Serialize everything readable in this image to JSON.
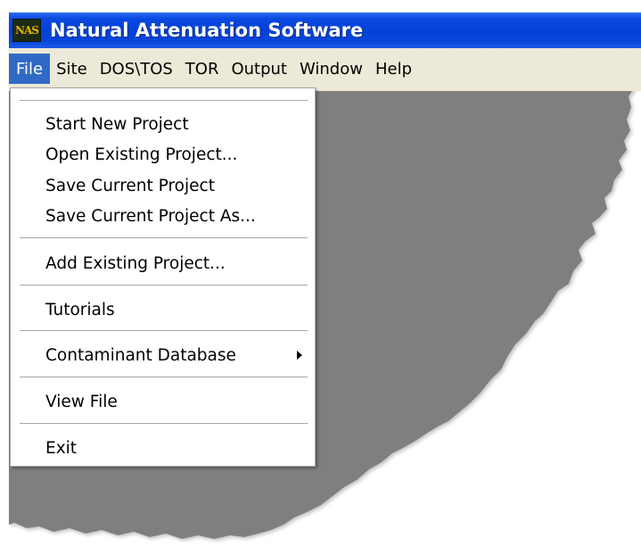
{
  "window": {
    "title": "Natural Attenuation Software",
    "icon_text": "NAS"
  },
  "menubar": {
    "items": [
      {
        "label": "File",
        "active": true
      },
      {
        "label": "Site"
      },
      {
        "label": "DOS\\TOS"
      },
      {
        "label": "TOR"
      },
      {
        "label": "Output"
      },
      {
        "label": "Window"
      },
      {
        "label": "Help"
      }
    ]
  },
  "file_menu": {
    "items": [
      "Start New Project",
      "Open Existing Project...",
      "Save Current Project",
      "Save Current Project As...",
      "Add Existing Project...",
      "Tutorials",
      "Contaminant Database",
      "View File",
      "Exit"
    ]
  },
  "colors": {
    "titlebar": "#0342d8",
    "menubar": "#ece9d8",
    "menu_highlight": "#316ac5",
    "workspace": "#7f7f7f"
  }
}
